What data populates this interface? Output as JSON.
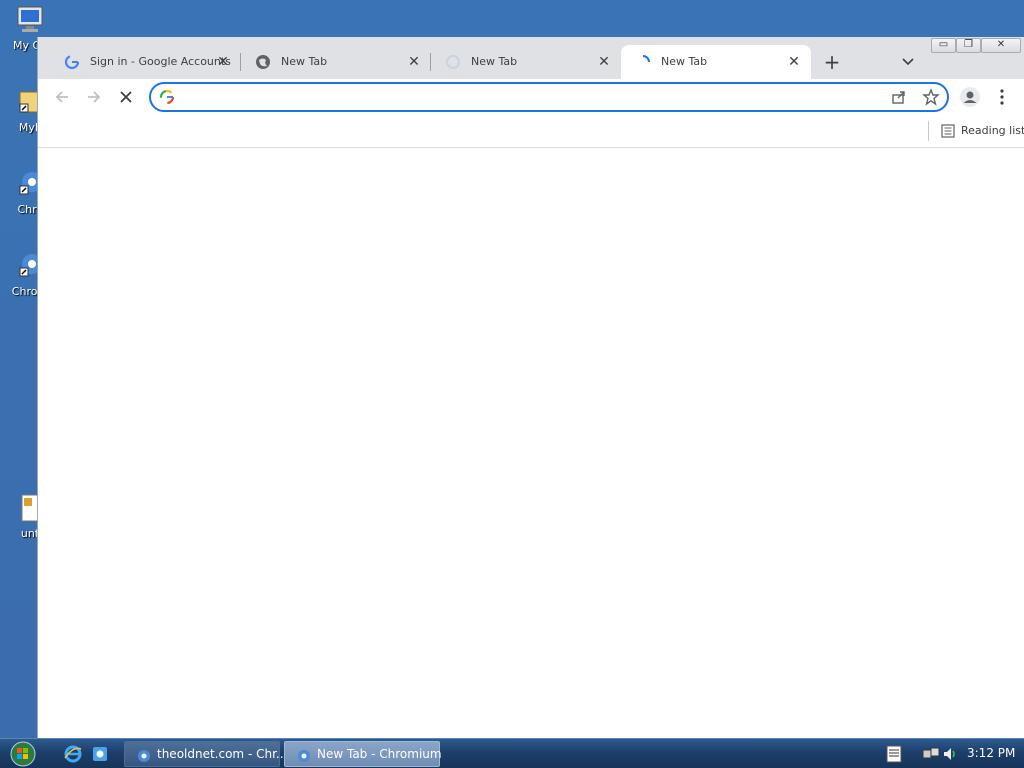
{
  "desktop": {
    "icons": [
      {
        "label": "My Co",
        "icon": "computer-icon"
      },
      {
        "label": "MyF",
        "icon": "folder-shortcut-icon"
      },
      {
        "label": "Chrc",
        "icon": "chromium-shortcut-icon"
      },
      {
        "label": "Chrom",
        "icon": "chromium-shortcut-icon"
      },
      {
        "label": "unt",
        "icon": "document-icon"
      }
    ]
  },
  "browser": {
    "tabs": [
      {
        "title": "Sign in - Google Accounts",
        "icon": "google-icon",
        "active": false
      },
      {
        "title": "New Tab",
        "icon": "globe-icon",
        "active": false
      },
      {
        "title": "New Tab",
        "icon": "faded-tab-icon",
        "active": false
      },
      {
        "title": "New Tab",
        "icon": "loading-spinner-icon",
        "active": true
      }
    ],
    "new_tab_symbol": "+",
    "close_symbol": "✕",
    "window_controls": {
      "minimize": "▭",
      "maximize": "❐",
      "close": "✕"
    },
    "omnibox": {
      "value": "",
      "placeholder": ""
    },
    "reading_list_label": "Reading list"
  },
  "taskbar": {
    "tasks": [
      {
        "label": "theoldnet.com - Chr...",
        "active": false
      },
      {
        "label": "New Tab - Chromium",
        "active": true
      }
    ],
    "clock": "3:12 PM"
  },
  "colors": {
    "accent": "#1a73e8",
    "tabstrip": "#dfe1e5",
    "desktop": "#3a6fb0",
    "taskbar": "#1d3f6b"
  }
}
